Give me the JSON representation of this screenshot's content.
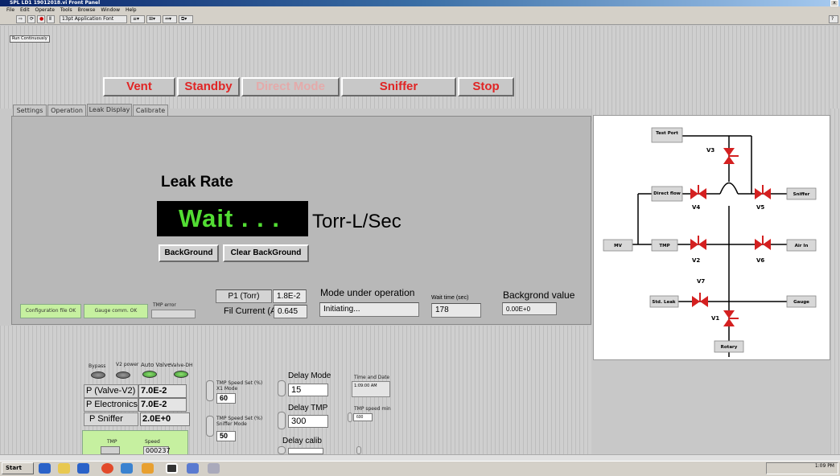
{
  "window": {
    "title": "SPL LD1 19012018.vi Front Panel"
  },
  "menu": [
    "File",
    "Edit",
    "Operate",
    "Tools",
    "Browse",
    "Window",
    "Help"
  ],
  "toolbar": {
    "font": "13pt Application Font"
  },
  "run_continuously": "Run Continuously",
  "mode_buttons": {
    "vent": "Vent",
    "standby": "Standby",
    "direct_mode": "Direct Mode",
    "sniffer": "Sniffer",
    "stop": "Stop"
  },
  "tabs": [
    "Settings",
    "Operation",
    "Leak Display",
    "Calibrate"
  ],
  "active_tab": "Leak Display",
  "leak": {
    "title": "Leak Rate",
    "value": "Wait . . .",
    "unit": "Torr-L/Sec"
  },
  "buttons": {
    "background": "BackGround",
    "clear_background": "Clear BackGround"
  },
  "status": {
    "config_file": "Configuration file OK",
    "gauge_comm": "Gauge comm. OK",
    "tmp_error_label": "TMP error"
  },
  "readouts": {
    "p1_label": "P1 (Torr)",
    "p1_value": "1.8E-2",
    "fil_label": "Fil Current (A)",
    "fil_value": "0.645",
    "mode_label": "Mode under operation",
    "mode_value": "Initiating...",
    "wait_label": "Wait time  (sec)",
    "wait_value": "178",
    "bg_label": "Backgrond value",
    "bg_value": "0.00E+0"
  },
  "diagram": {
    "test_port": "Test Port",
    "direct_flow": "Direct flow",
    "sniffer": "Sniffer",
    "mv": "MV",
    "tmp": "TMP",
    "air_in": "Air In",
    "std_leak": "Std. Leak",
    "gauge": "Gauge",
    "rotary": "Rotary",
    "v1": "V1",
    "v2": "V2",
    "v3": "V3",
    "v4": "V4",
    "v5": "V5",
    "v6": "V6",
    "v7": "V7"
  },
  "bottom": {
    "indicators": [
      "Bypass",
      "V2 power",
      "Auto Valve",
      "Valve-DH"
    ],
    "pressures": [
      {
        "label": "P (Valve-V2)",
        "value": "7.0E-2"
      },
      {
        "label": "P Electronics",
        "value": "7.0E-2"
      },
      {
        "label": "P Sniffer",
        "value": "2.0E+0"
      }
    ],
    "tmp_speed_x1_label": "TMP Speed Set (%) X1 Mode",
    "tmp_speed_x1_value": "60",
    "tmp_speed_sniffer_label": "TMP Speed Set (%) Sniffer Mode",
    "tmp_speed_sniffer_value": "50",
    "delay_mode_label": "Delay Mode",
    "delay_mode_value": "15",
    "delay_tmp_label": "Delay TMP",
    "delay_tmp_value": "300",
    "delay_calib_label": "Delay calib",
    "time_date_label": "Time and Date",
    "time_date_value": "1:09:00 AM",
    "tmp_speed_min_label": "TMP speed min",
    "tmp_speed_min_value": "600",
    "tmp_label": "TMP",
    "speed_label": "Speed",
    "speed_value": "000237"
  },
  "taskbar": {
    "start": "Start",
    "time": "1:09 PM"
  },
  "colors": {
    "accent_red": "#e02525",
    "lcd_green": "#52dd33",
    "ok_green": "#c6f0a0",
    "valve_red": "#d42020"
  }
}
